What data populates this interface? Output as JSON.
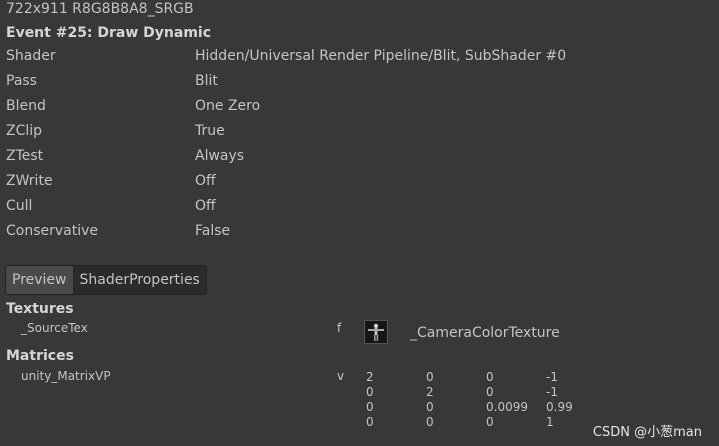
{
  "format_line": "722x911 R8G8B8A8_SRGB",
  "event_title": "Event #25: Draw Dynamic",
  "properties": [
    {
      "name": "Shader",
      "value": "Hidden/Universal Render Pipeline/Blit, SubShader #0"
    },
    {
      "name": "Pass",
      "value": "Blit"
    },
    {
      "name": "Blend",
      "value": "One Zero"
    },
    {
      "name": "ZClip",
      "value": "True"
    },
    {
      "name": "ZTest",
      "value": "Always"
    },
    {
      "name": "ZWrite",
      "value": "Off"
    },
    {
      "name": "Cull",
      "value": "Off"
    },
    {
      "name": "Conservative",
      "value": "False"
    }
  ],
  "tabs": [
    {
      "label": "Preview",
      "active": true
    },
    {
      "label": "ShaderProperties",
      "active": false
    }
  ],
  "textures": {
    "header": "Textures",
    "items": [
      {
        "name": "_SourceTex",
        "type": "f",
        "value": "_CameraColorTexture"
      }
    ]
  },
  "matrices": {
    "header": "Matrices",
    "items": [
      {
        "name": "unity_MatrixVP",
        "type": "v",
        "rows": [
          [
            "2",
            "0",
            "0",
            "-1"
          ],
          [
            "0",
            "2",
            "0",
            "-1"
          ],
          [
            "0",
            "0",
            "0.0099",
            "0.99"
          ],
          [
            "0",
            "0",
            "0",
            "1"
          ]
        ]
      }
    ]
  },
  "watermark": "CSDN @小葱man"
}
